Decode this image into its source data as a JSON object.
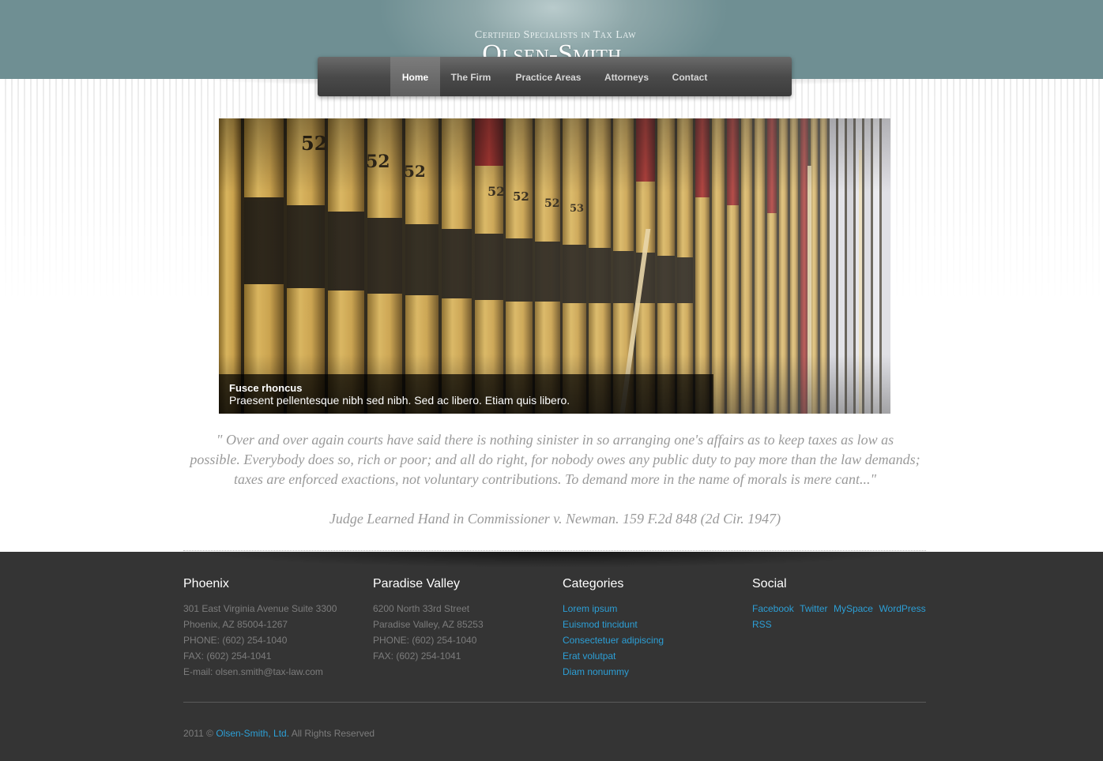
{
  "brand": {
    "tagline": "Certified Specialists in Tax Law",
    "name": "Olsen-Smith, Ltd"
  },
  "nav": {
    "items": [
      {
        "label": "Home",
        "active": true
      },
      {
        "label": "The Firm",
        "active": false
      },
      {
        "label": "Practice Areas",
        "active": false
      },
      {
        "label": "Attorneys",
        "active": false
      },
      {
        "label": "Contact",
        "active": false
      }
    ]
  },
  "slider": {
    "image_subject": "law-books-on-shelf",
    "caption_title": "Fusce rhoncus",
    "caption_text": "Praesent pellentesque nibh sed nibh. Sed ac libero. Etiam quis libero."
  },
  "quote": {
    "text": "\"  Over and over again courts have said there is nothing sinister in so arranging one's affairs as to keep taxes as low as possible. Everybody does so, rich or poor; and all do right, for nobody owes any public duty to pay more than the law demands; taxes are enforced exactions, not voluntary contributions. To demand more in the name of morals is mere cant...\"",
    "source": "Judge Learned Hand in Commissioner v. Newman. 159 F.2d 848 (2d Cir. 1947)"
  },
  "footer": {
    "phoenix": {
      "title": "Phoenix",
      "lines": [
        "301 East Virginia Avenue Suite 3300",
        "Phoenix, AZ 85004-1267",
        "PHONE: (602) 254-1040",
        "FAX: (602) 254-1041",
        "E-mail: olsen.smith@tax-law.com"
      ]
    },
    "paradise_valley": {
      "title": "Paradise Valley",
      "lines": [
        "6200 North 33rd Street",
        "Paradise Valley, AZ 85253",
        "PHONE: (602) 254-1040",
        "FAX: (602) 254-1041"
      ]
    },
    "categories": {
      "title": "Categories",
      "links": [
        "Lorem ipsum",
        "Euismod tincidunt",
        "Consectetuer adipiscing",
        "Erat volutpat",
        "Diam nonummy"
      ]
    },
    "social": {
      "title": "Social",
      "links": [
        "Facebook",
        "Twitter",
        "MySpace",
        "WordPress",
        "RSS"
      ]
    },
    "copyright_prefix": "2011 © ",
    "copyright_brand": "Olsen-Smith, Ltd.",
    "copyright_suffix": " All Rights Reserved"
  },
  "colors": {
    "header": "#7f9b9e",
    "nav_bar": "#4a4a4a",
    "footer_bg": "#343434",
    "link": "#2c9fd6",
    "quote_text": "#9a9a9a"
  }
}
